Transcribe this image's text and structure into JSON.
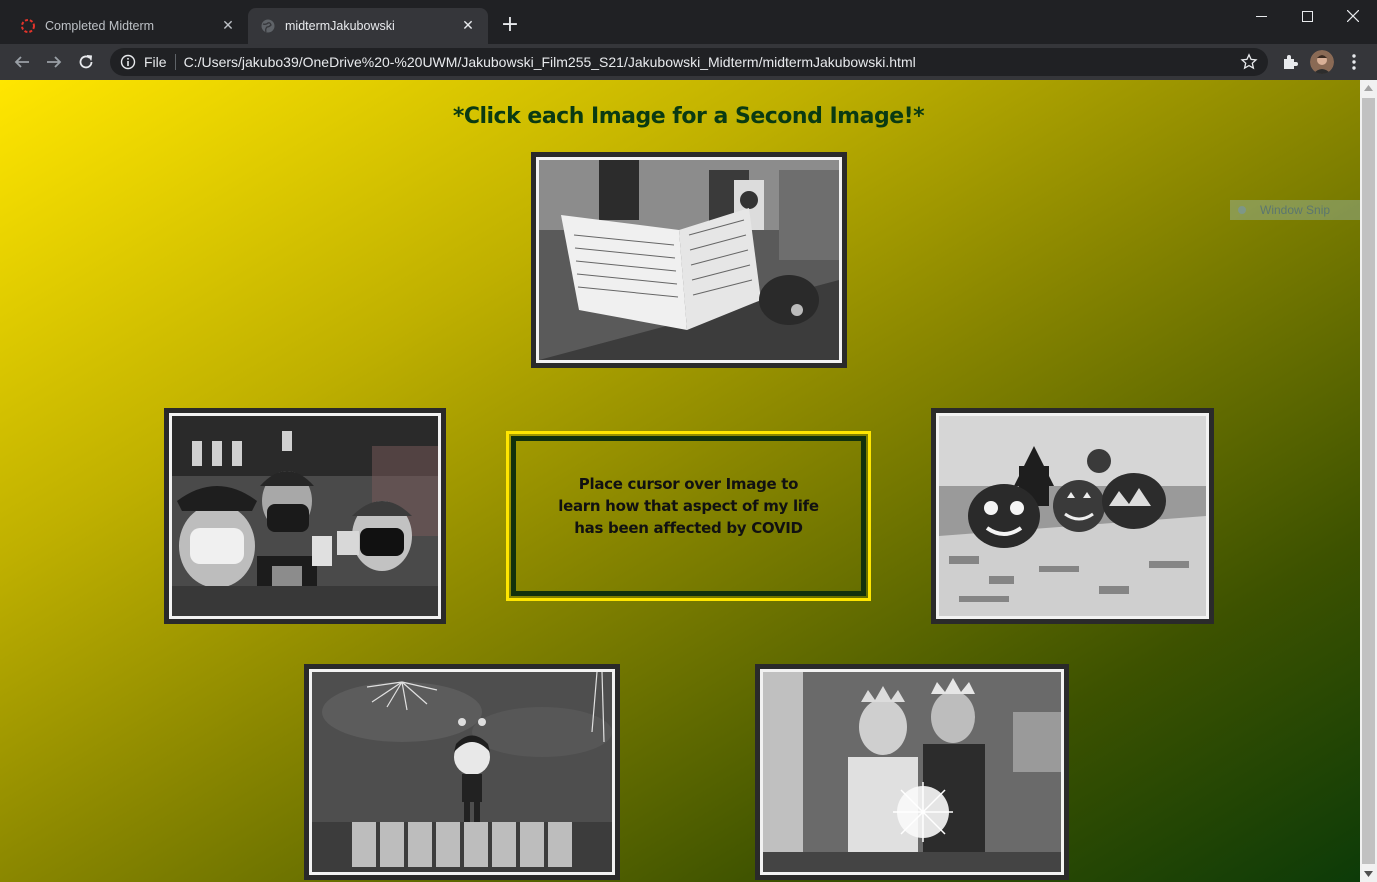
{
  "browser": {
    "tabs": [
      {
        "title": "Completed Midterm",
        "close": "✕",
        "favicon": "circle-dots-icon",
        "active": false
      },
      {
        "title": "midtermJakubowski",
        "close": "✕",
        "favicon": "globe-icon",
        "active": true
      }
    ],
    "new_tab": "+",
    "window_controls": {
      "minimize": "—",
      "maximize": "☐",
      "close": "✕"
    },
    "omnibox": {
      "scheme": "File",
      "url": "C:/Users/jakubo39/OneDrive%20-%20UWM/Jakubowski_Film255_S21/Jakubowski_Midterm/midtermJakubowski.html"
    }
  },
  "page": {
    "heading": "*Click each Image for a Second Image!*",
    "info_message": "Place cursor over Image to learn how that aspect of my life has been affected by COVID",
    "images": [
      {
        "name": "notebook-photo",
        "subject": "open notebook"
      },
      {
        "name": "coworkers-photo",
        "subject": "coworkers in masks"
      },
      {
        "name": "pumpkins-photo",
        "subject": "carved pumpkins"
      },
      {
        "name": "game-character-photo",
        "subject": "video game character"
      },
      {
        "name": "friends-crowns-photo",
        "subject": "friends with crowns"
      }
    ],
    "colors": {
      "gradient_start": "#ffe600",
      "gradient_end": "#0b3a08",
      "heading": "#0a3a12",
      "info_border_outer": "#ffe600",
      "info_border_inner": "#12310c"
    }
  },
  "overlay": {
    "snip_label": "Window Snip"
  }
}
